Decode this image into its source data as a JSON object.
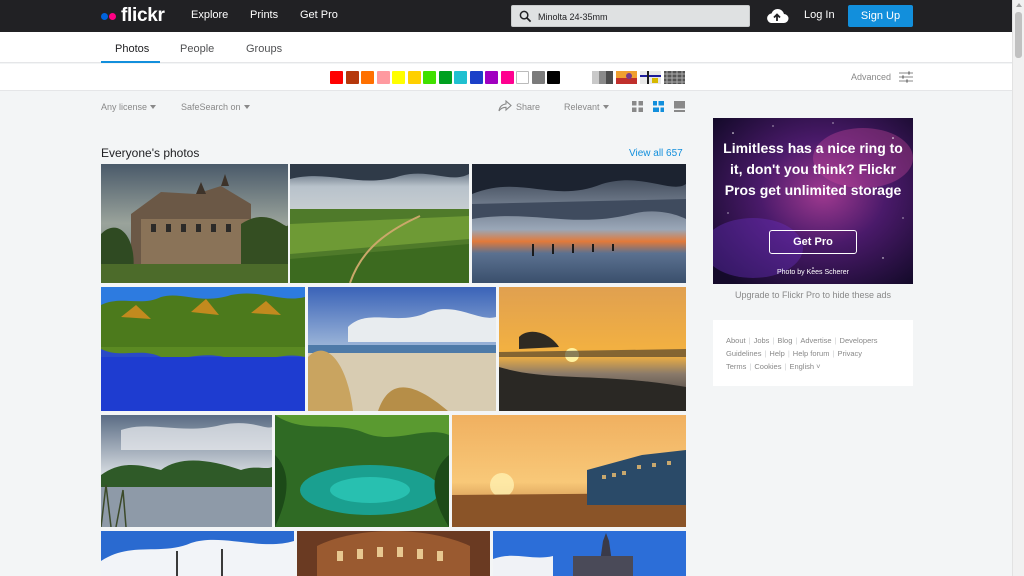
{
  "brand": {
    "name": "flickr",
    "colors": {
      "blue": "#0063dc",
      "pink": "#ff0084",
      "accent": "#128fdc"
    }
  },
  "topnav": {
    "links": [
      "Explore",
      "Prints",
      "Get Pro"
    ],
    "search": {
      "value": "Minolta 24-35mm",
      "icon": "search-icon"
    },
    "upload_icon": "cloud-upload-icon",
    "login": "Log In",
    "signup": "Sign Up"
  },
  "tabs": [
    {
      "label": "Photos",
      "active": true
    },
    {
      "label": "People",
      "active": false
    },
    {
      "label": "Groups",
      "active": false
    }
  ],
  "color_filters": [
    "#ff0000",
    "#b5380c",
    "#ff7000",
    "#ff9aa0",
    "#ffff00",
    "#ffd000",
    "#40e000",
    "#00a020",
    "#20c0d0",
    "#1b40c8",
    "#a000c0",
    "#ff0090",
    "#ffffff",
    "#7b7b7b",
    "#000000"
  ],
  "style_filters": [
    "black-and-white",
    "shallow-depth-of-field",
    "minimalism",
    "patterns"
  ],
  "advanced": "Advanced",
  "filters": {
    "license": "Any license",
    "safesearch": "SafeSearch on",
    "share": "Share",
    "sort": "Relevant"
  },
  "section": {
    "title": "Everyone's photos",
    "view_all": "View all 657"
  },
  "ad": {
    "text": "Limitless has a nice ring to it, don't you think? Flickr Pros get unlimited storage",
    "button": "Get Pro",
    "credit": "Photo by Kees Scherer",
    "upgrade": "Upgrade to Flickr Pro to hide these ads"
  },
  "footer": {
    "row1": [
      "About",
      "Jobs",
      "Blog",
      "Advertise",
      "Developers"
    ],
    "row2": [
      "Guidelines",
      "Help",
      "Help forum",
      "Privacy"
    ],
    "row3": [
      "Terms",
      "Cookies",
      "English"
    ]
  }
}
